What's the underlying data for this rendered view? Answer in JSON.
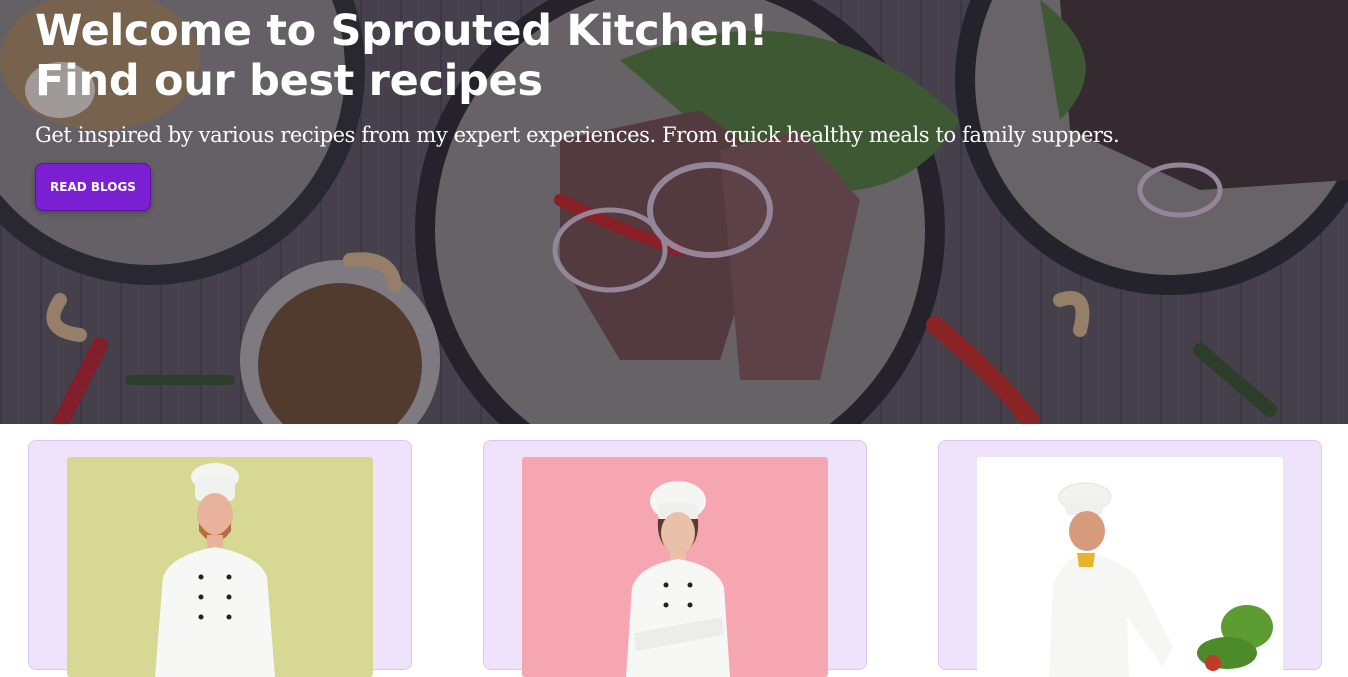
{
  "hero": {
    "title_line1": "Welcome to Sprouted Kitchen!",
    "title_line2": "Find our best recipes",
    "subtitle": "Get inspired by various recipes from my expert experiences. From quick healthy meals to family suppers.",
    "cta_label": "READ BLOGS",
    "accent": "#7a1fd1"
  },
  "cards": [
    {
      "photo_bg": "#d6d894",
      "icon": "chef-photo"
    },
    {
      "photo_bg": "#f6a6b1",
      "icon": "chef-photo"
    },
    {
      "photo_bg": "#ffffff",
      "icon": "chef-photo"
    }
  ],
  "colors": {
    "card_bg": "#efe3fb",
    "card_border": "#dcc6f3"
  }
}
